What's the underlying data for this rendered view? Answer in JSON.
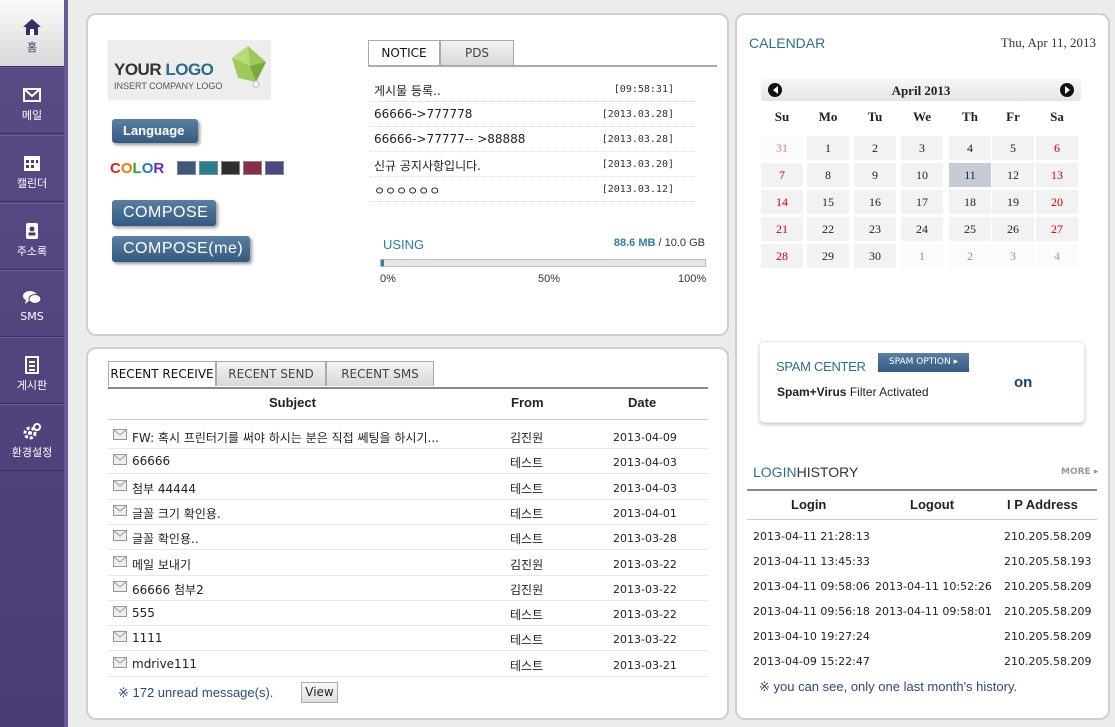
{
  "sidebar": {
    "items": [
      {
        "label": "홈",
        "icon": "home-icon"
      },
      {
        "label": "메일",
        "icon": "mail-icon"
      },
      {
        "label": "캘린더",
        "icon": "calendar-icon"
      },
      {
        "label": "주소록",
        "icon": "address-book-icon"
      },
      {
        "label": "SMS",
        "icon": "chat-icon"
      },
      {
        "label": "게시판",
        "icon": "board-icon"
      },
      {
        "label": "환경설정",
        "icon": "gear-icon"
      }
    ]
  },
  "logo": {
    "line1_a": "YOUR ",
    "line1_b": "LOGO",
    "line2": "INSERT COMPANY LOGO"
  },
  "language_label": "Language",
  "color_label": "COLOR",
  "color_swatches": [
    "#3e5a7a",
    "#2a8090",
    "#2e2e2e",
    "#8a2f4a",
    "#4a4a80"
  ],
  "compose_label": "COMPOSE",
  "compose_me_label": "COMPOSE(me)",
  "notice": {
    "tabs": [
      "NOTICE",
      "PDS"
    ],
    "rows": [
      {
        "title": "게시물 등록..",
        "date": "[09:58:31]"
      },
      {
        "title": "66666->777778",
        "date": "[2013.03.28]"
      },
      {
        "title": "66666->77777-- >88888",
        "date": "[2013.03.28]"
      },
      {
        "title": "신규 공지사항입니다.",
        "date": "[2013.03.20]"
      },
      {
        "title": "ㅇㅇㅇㅇㅇㅇ",
        "date": "[2013.03.12]"
      }
    ]
  },
  "usage": {
    "label": "USING",
    "used": "88.6 MB",
    "sep": " / ",
    "total": "10.0 GB",
    "fraction": 0.009,
    "ticks": [
      "0%",
      "50%",
      "100%"
    ]
  },
  "mail": {
    "tabs": [
      "RECENT RECEIVE",
      "RECENT SEND",
      "RECENT SMS"
    ],
    "columns": [
      "Subject",
      "From",
      "Date"
    ],
    "rows": [
      {
        "subject": "FW: 혹시 프린터기를 써야 하시는 분은 직접 쎄팅을 하시기...",
        "from": "김진원",
        "date": "2013-04-09"
      },
      {
        "subject": "66666",
        "from": "테스트",
        "date": "2013-04-03"
      },
      {
        "subject": "첨부 44444",
        "from": "테스트",
        "date": "2013-04-03"
      },
      {
        "subject": "글꼴 크기 확인용.",
        "from": "테스트",
        "date": "2013-04-01"
      },
      {
        "subject": "글꼴 확인용..",
        "from": "테스트",
        "date": "2013-03-28"
      },
      {
        "subject": "메일 보내기",
        "from": "김진원",
        "date": "2013-03-22"
      },
      {
        "subject": "66666 첨부2",
        "from": "김진원",
        "date": "2013-03-22"
      },
      {
        "subject": "555",
        "from": "테스트",
        "date": "2013-03-22"
      },
      {
        "subject": "1111",
        "from": "테스트",
        "date": "2013-03-22"
      },
      {
        "subject": "mdrive111",
        "from": "테스트",
        "date": "2013-03-21"
      }
    ],
    "unread_text": "※ 172 unread message(s).",
    "view_label": "View"
  },
  "calendar": {
    "title": "CALENDAR",
    "today_text": "Thu, Apr 11, 2013",
    "month_label": "April 2013",
    "weekdays": [
      "Su",
      "Mo",
      "Tu",
      "We",
      "Th",
      "Fr",
      "Sa"
    ],
    "weeks": [
      [
        "31",
        "1",
        "2",
        "3",
        "4",
        "5",
        "6"
      ],
      [
        "7",
        "8",
        "9",
        "10",
        "11",
        "12",
        "13"
      ],
      [
        "14",
        "15",
        "16",
        "17",
        "18",
        "19",
        "20"
      ],
      [
        "21",
        "22",
        "23",
        "24",
        "25",
        "26",
        "27"
      ],
      [
        "28",
        "29",
        "30",
        "1",
        "2",
        "3",
        "4"
      ]
    ],
    "today": "11",
    "sunday_color": "#cc0000",
    "saturday_color": "#cc0000",
    "other_month_color": "#999999",
    "today_bg": "#c6ccd6"
  },
  "spam": {
    "title": "SPAM CENTER",
    "option_label": "SPAM OPTION ▸",
    "status_bold": "Spam+Virus",
    "status_rest": " Filter Activated",
    "state": "on"
  },
  "login_history": {
    "title_a": "LOGIN",
    "title_b": "HISTORY",
    "more_label": "MORE ▸",
    "columns": [
      "Login",
      "Logout",
      "I P Address"
    ],
    "rows": [
      {
        "login": "2013-04-11 21:28:13",
        "logout": "",
        "ip": "210.205.58.209"
      },
      {
        "login": "2013-04-11 13:45:33",
        "logout": "",
        "ip": "210.205.58.193"
      },
      {
        "login": "2013-04-11 09:58:06",
        "logout": "2013-04-11 10:52:26",
        "ip": "210.205.58.209"
      },
      {
        "login": "2013-04-11 09:56:18",
        "logout": "2013-04-11 09:58:01",
        "ip": "210.205.58.209"
      },
      {
        "login": "2013-04-10 19:27:24",
        "logout": "",
        "ip": "210.205.58.209"
      },
      {
        "login": "2013-04-09 15:22:47",
        "logout": "",
        "ip": "210.205.58.209"
      }
    ],
    "note": "※ you can see, only one last month's history."
  }
}
